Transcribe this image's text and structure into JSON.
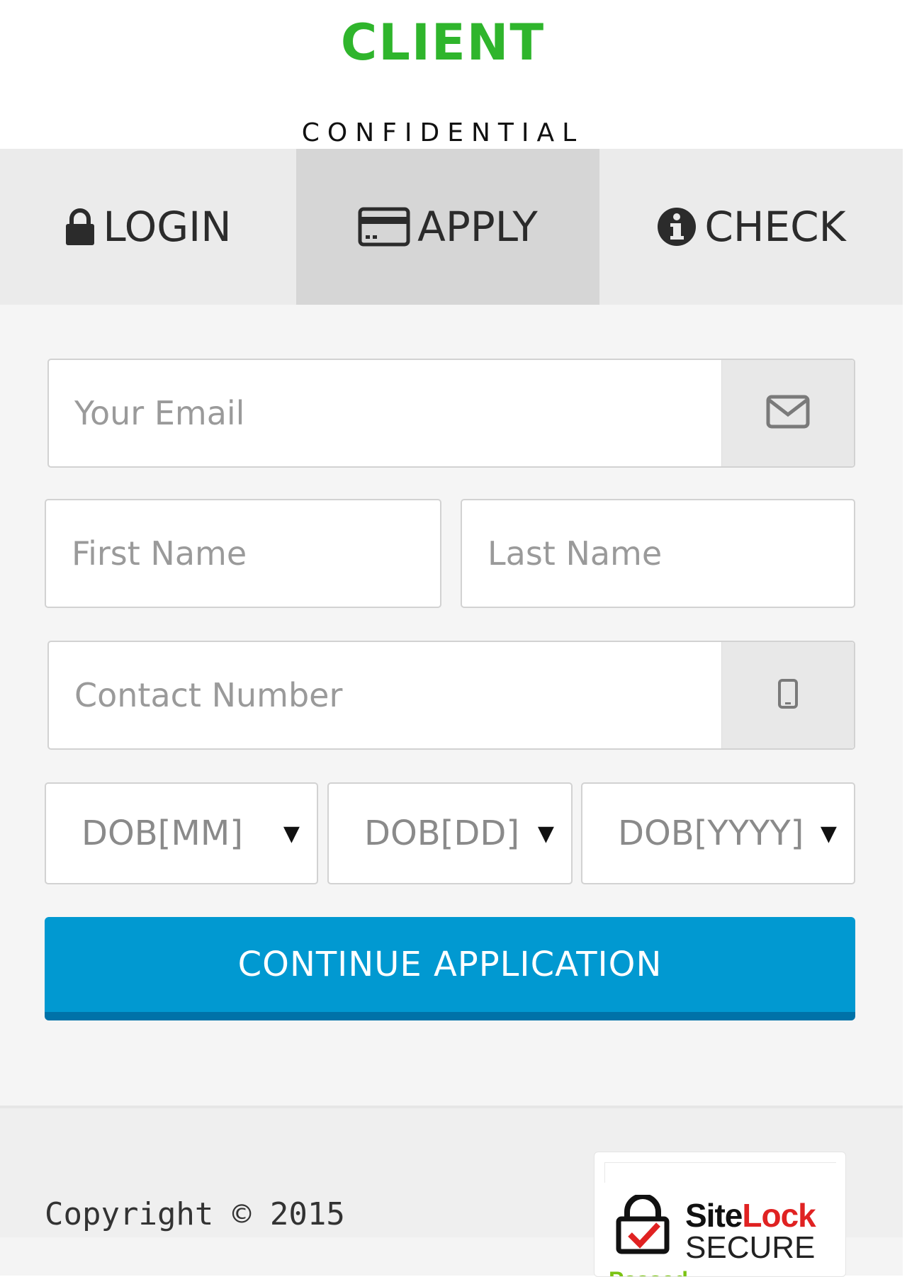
{
  "brand": {
    "title": "CLIENT",
    "subtitle": "CONFIDENTIAL",
    "color": "#2fb52c"
  },
  "tabs": [
    {
      "label": "LOGIN",
      "icon": "lock-icon",
      "active": false
    },
    {
      "label": "APPLY",
      "icon": "credit-card-icon",
      "active": true
    },
    {
      "label": "CHECK",
      "icon": "info-icon",
      "active": false
    }
  ],
  "form": {
    "email": {
      "placeholder": "Your Email",
      "icon": "envelope-icon"
    },
    "first_name": {
      "placeholder": "First Name"
    },
    "last_name": {
      "placeholder": "Last Name"
    },
    "contact": {
      "placeholder": "Contact Number",
      "icon": "mobile-phone-icon"
    },
    "dob_mm": {
      "value": "DOB[MM]"
    },
    "dob_dd": {
      "value": "DOB[DD]"
    },
    "dob_yyyy": {
      "value": "DOB[YYYY]"
    },
    "submit_label": "CONTINUE APPLICATION",
    "accent": "#0199d1"
  },
  "footer": {
    "copyright": "Copyright © 2015",
    "badge": {
      "brand_site": "Site",
      "brand_lock": "Lock",
      "secure": "SECURE",
      "passed": "Passed"
    }
  }
}
